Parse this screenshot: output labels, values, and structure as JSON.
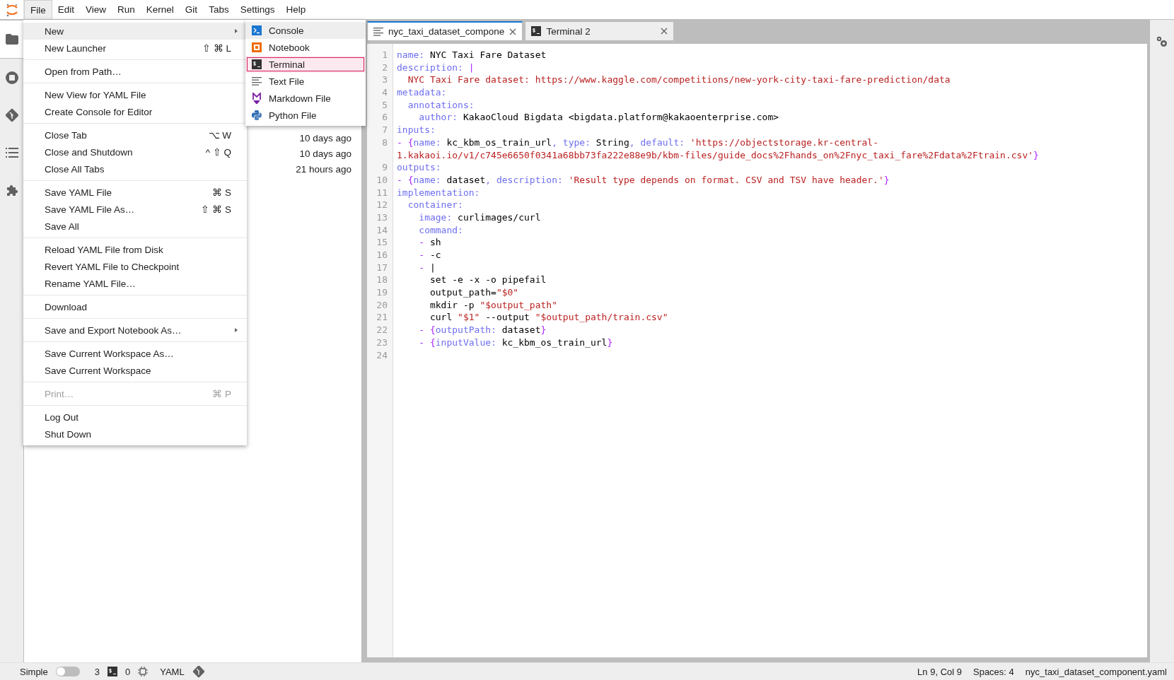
{
  "menubar": {
    "items": [
      {
        "label": "File",
        "selected": true
      },
      {
        "label": "Edit",
        "selected": false
      },
      {
        "label": "View",
        "selected": false
      },
      {
        "label": "Run",
        "selected": false
      },
      {
        "label": "Kernel",
        "selected": false
      },
      {
        "label": "Git",
        "selected": false
      },
      {
        "label": "Tabs",
        "selected": false
      },
      {
        "label": "Settings",
        "selected": false
      },
      {
        "label": "Help",
        "selected": false
      }
    ]
  },
  "left_sidebar": {
    "items": [
      {
        "kind": "folder",
        "selected": true
      },
      {
        "kind": "running",
        "selected": false
      },
      {
        "kind": "git",
        "selected": false
      },
      {
        "kind": "toc",
        "selected": false
      },
      {
        "kind": "extensions",
        "selected": false
      }
    ]
  },
  "file_browser": {
    "modified": [
      "10 days ago",
      "10 days ago",
      "21 hours ago"
    ]
  },
  "file_menu": {
    "items": [
      {
        "kind": "item",
        "label": "New",
        "submenu": true,
        "selected": true,
        "disabled": false
      },
      {
        "kind": "item",
        "label": "New Launcher",
        "shortcut": "⇧ ⌘ L",
        "selected": false,
        "disabled": false
      },
      {
        "kind": "separator"
      },
      {
        "kind": "item",
        "label": "Open from Path…",
        "selected": false,
        "disabled": false
      },
      {
        "kind": "separator"
      },
      {
        "kind": "item",
        "label": "New View for YAML File",
        "selected": false,
        "disabled": false
      },
      {
        "kind": "item",
        "label": "Create Console for Editor",
        "selected": false,
        "disabled": false
      },
      {
        "kind": "separator"
      },
      {
        "kind": "item",
        "label": "Close Tab",
        "shortcut": "⌥ W",
        "selected": false,
        "disabled": false
      },
      {
        "kind": "item",
        "label": "Close and Shutdown",
        "shortcut": "^ ⇧ Q",
        "selected": false,
        "disabled": false
      },
      {
        "kind": "item",
        "label": "Close All Tabs",
        "selected": false,
        "disabled": false
      },
      {
        "kind": "separator"
      },
      {
        "kind": "item",
        "label": "Save YAML File",
        "shortcut": "⌘ S",
        "selected": false,
        "disabled": false
      },
      {
        "kind": "item",
        "label": "Save YAML File As…",
        "shortcut": "⇧ ⌘ S",
        "selected": false,
        "disabled": false
      },
      {
        "kind": "item",
        "label": "Save All",
        "selected": false,
        "disabled": false
      },
      {
        "kind": "separator"
      },
      {
        "kind": "item",
        "label": "Reload YAML File from Disk",
        "selected": false,
        "disabled": false
      },
      {
        "kind": "item",
        "label": "Revert YAML File to Checkpoint",
        "selected": false,
        "disabled": false
      },
      {
        "kind": "item",
        "label": "Rename YAML File…",
        "selected": false,
        "disabled": false
      },
      {
        "kind": "separator"
      },
      {
        "kind": "item",
        "label": "Download",
        "selected": false,
        "disabled": false
      },
      {
        "kind": "separator"
      },
      {
        "kind": "item",
        "label": "Save and Export Notebook As…",
        "submenu": true,
        "selected": false,
        "disabled": false
      },
      {
        "kind": "separator"
      },
      {
        "kind": "item",
        "label": "Save Current Workspace As…",
        "selected": false,
        "disabled": false
      },
      {
        "kind": "item",
        "label": "Save Current Workspace",
        "selected": false,
        "disabled": false
      },
      {
        "kind": "separator"
      },
      {
        "kind": "item",
        "label": "Print…",
        "shortcut": "⌘ P",
        "selected": false,
        "disabled": true
      },
      {
        "kind": "separator"
      },
      {
        "kind": "item",
        "label": "Log Out",
        "selected": false,
        "disabled": false
      },
      {
        "kind": "item",
        "label": "Shut Down",
        "selected": false,
        "disabled": false
      }
    ]
  },
  "new_submenu": {
    "items": [
      {
        "kind": "console",
        "label": "Console",
        "selected": true,
        "focused": false
      },
      {
        "kind": "notebook",
        "label": "Notebook",
        "selected": false,
        "focused": false
      },
      {
        "kind": "terminal",
        "label": "Terminal",
        "selected": false,
        "focused": true
      },
      {
        "kind": "text",
        "label": "Text File",
        "selected": false,
        "focused": false
      },
      {
        "kind": "markdown",
        "label": "Markdown File",
        "selected": false,
        "focused": false
      },
      {
        "kind": "python",
        "label": "Python File",
        "selected": false,
        "focused": false
      }
    ]
  },
  "tabs": [
    {
      "kind": "file",
      "label": "nyc_taxi_dataset_compone",
      "selected": true
    },
    {
      "kind": "terminal",
      "label": "Terminal 2",
      "selected": false
    }
  ],
  "editor": {
    "lines": [
      {
        "n": "1",
        "tokens": [
          {
            "key": "name:"
          },
          {
            "plain": " NYC Taxi Fare Dataset"
          }
        ]
      },
      {
        "n": "2",
        "tokens": [
          {
            "key": "description:"
          },
          {
            "punct": " |"
          }
        ]
      },
      {
        "n": "3",
        "tokens": [
          {
            "str": "  NYC Taxi Fare dataset: https://www.kaggle.com/competitions/new-york-city-taxi-fare-prediction/data"
          }
        ]
      },
      {
        "n": "4",
        "tokens": [
          {
            "key": "metadata:"
          }
        ]
      },
      {
        "n": "5",
        "tokens": [
          {
            "key": "  annotations:"
          }
        ]
      },
      {
        "n": "6",
        "tokens": [
          {
            "key": "    author:"
          },
          {
            "plain": " KakaoCloud Bigdata <bigdata.platform@kakaoenterprise.com>"
          }
        ]
      },
      {
        "n": "7",
        "tokens": [
          {
            "key": "inputs:"
          }
        ]
      },
      {
        "n": "8",
        "tokens": [
          {
            "punct": "- {"
          },
          {
            "key": "name:"
          },
          {
            "plain": " kc_kbm_os_train_url"
          },
          {
            "key": ", type:"
          },
          {
            "plain": " String"
          },
          {
            "key": ", default:"
          },
          {
            "str": " 'https://objectstorage.kr-central-"
          }
        ]
      },
      {
        "tokens": [
          {
            "str": "1.kakaoi.io/v1/c745e6650f0341a68bb73fa222e88e9b/kbm-files/guide_docs%2Fhands_on%2Fnyc_taxi_fare%2Fdata%2Ftrain.csv'"
          },
          {
            "punct": "}"
          }
        ]
      },
      {
        "n": "9",
        "tokens": [
          {
            "key": "outputs:"
          }
        ]
      },
      {
        "n": "10",
        "tokens": [
          {
            "punct": "- {"
          },
          {
            "key": "name:"
          },
          {
            "plain": " dataset"
          },
          {
            "key": ", description:"
          },
          {
            "str": " 'Result type depends on format. CSV and TSV have header.'"
          },
          {
            "punct": "}"
          }
        ]
      },
      {
        "n": "11",
        "tokens": [
          {
            "key": "implementation:"
          }
        ]
      },
      {
        "n": "12",
        "tokens": [
          {
            "key": "  container:"
          }
        ]
      },
      {
        "n": "13",
        "tokens": [
          {
            "key": "    image:"
          },
          {
            "plain": " curlimages/curl"
          }
        ]
      },
      {
        "n": "14",
        "tokens": [
          {
            "key": "    command:"
          }
        ]
      },
      {
        "n": "15",
        "tokens": [
          {
            "punct": "    -"
          },
          {
            "plain": " sh"
          }
        ]
      },
      {
        "n": "16",
        "tokens": [
          {
            "punct": "    -"
          },
          {
            "plain": " -c"
          }
        ]
      },
      {
        "n": "17",
        "tokens": [
          {
            "punct": "    -"
          },
          {
            "plain": " |"
          }
        ]
      },
      {
        "n": "18",
        "tokens": [
          {
            "plain": "      set -e -x -o pipefail"
          }
        ]
      },
      {
        "n": "19",
        "tokens": [
          {
            "plain": "      output_path="
          },
          {
            "str": "\"$0\""
          }
        ]
      },
      {
        "n": "20",
        "tokens": [
          {
            "plain": "      mkdir -p "
          },
          {
            "str": "\"$output_path\""
          }
        ]
      },
      {
        "n": "21",
        "tokens": [
          {
            "plain": "      curl "
          },
          {
            "str": "\"$1\""
          },
          {
            "plain": " --output "
          },
          {
            "str": "\"$output_path/train.csv\""
          }
        ]
      },
      {
        "n": "22",
        "tokens": [
          {
            "punct": "    - {"
          },
          {
            "key": "outputPath:"
          },
          {
            "plain": " dataset"
          },
          {
            "punct": "}"
          }
        ]
      },
      {
        "n": "23",
        "tokens": [
          {
            "punct": "    - {"
          },
          {
            "key": "inputValue:"
          },
          {
            "plain": " kc_kbm_os_train_url"
          },
          {
            "punct": "}"
          }
        ]
      },
      {
        "n": "24"
      }
    ]
  },
  "status_bar": {
    "mode_label": "Simple",
    "simple_mode": false,
    "terminal_count": "3",
    "kernel_count": "0",
    "language": "YAML",
    "position": "Ln 9, Col 9",
    "spaces": "Spaces: 4",
    "filename": "nyc_taxi_dataset_component.yaml"
  }
}
